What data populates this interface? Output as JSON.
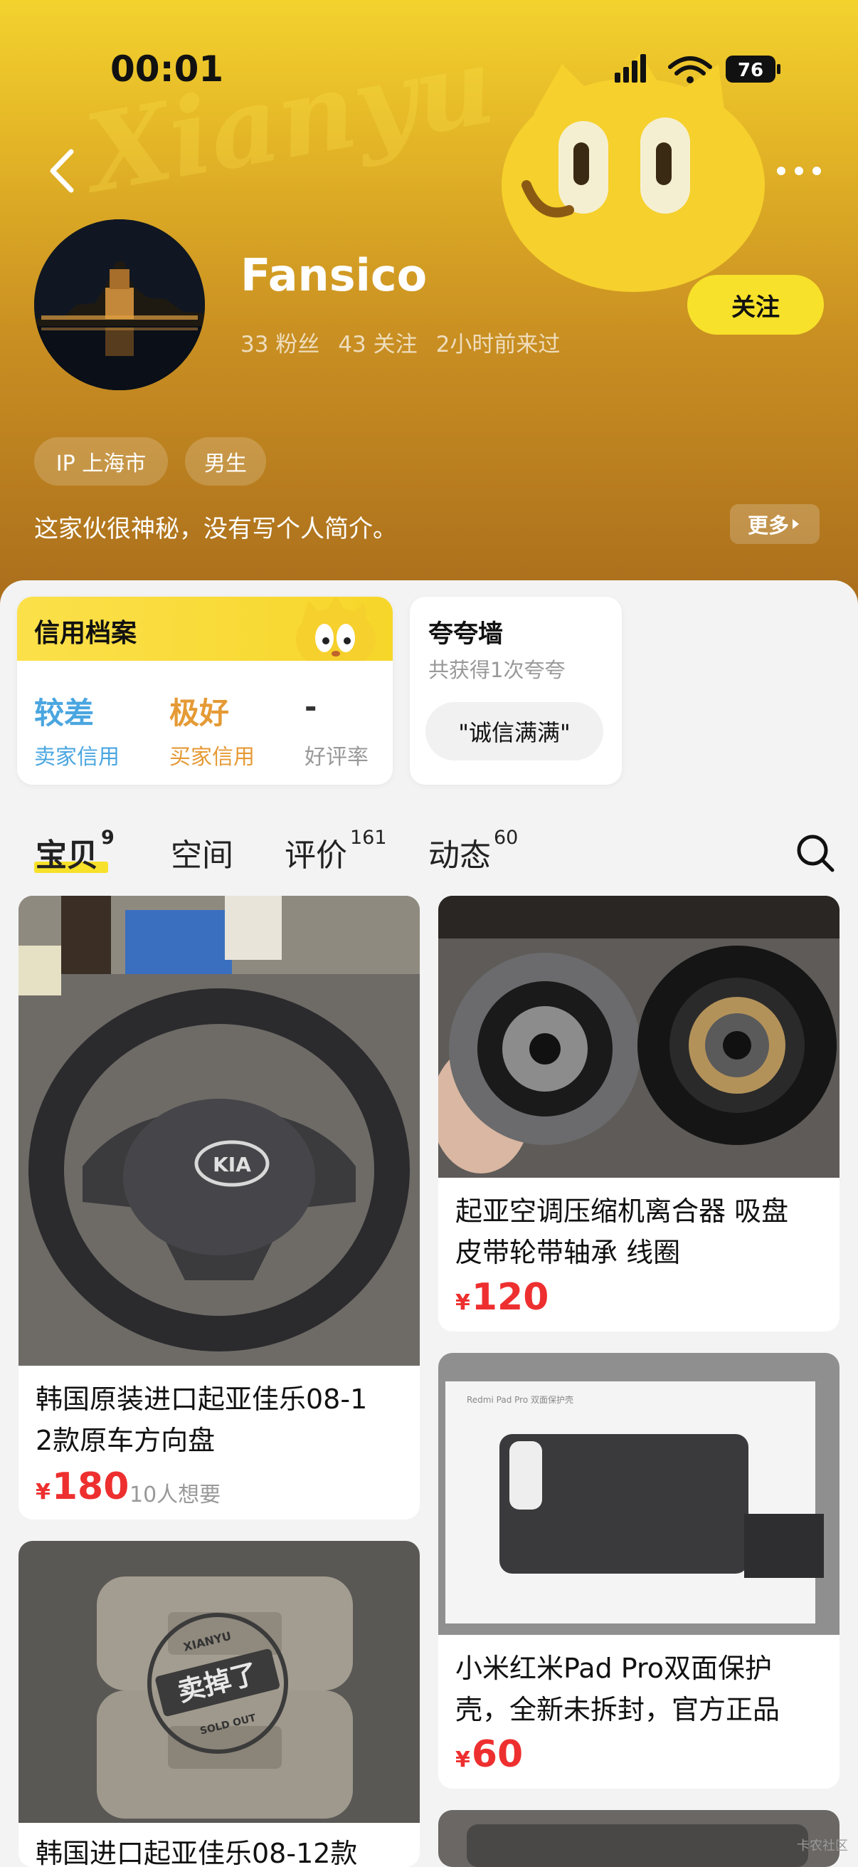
{
  "status_bar": {
    "time": "00:01",
    "battery": "76"
  },
  "profile": {
    "username": "Fansico",
    "stats": [
      "33 粉丝",
      "43 关注",
      "2小时前来过"
    ],
    "follow_label": "关注",
    "tags": [
      "IP 上海市",
      "男生"
    ],
    "bio": "这家伙很神秘，没有写个人简介。",
    "more_label": "更多"
  },
  "credit": {
    "title": "信用档案",
    "items": [
      {
        "value": "较差",
        "label": "卖家信用",
        "color": "#4aa6e0"
      },
      {
        "value": "极好",
        "label": "买家信用",
        "color": "#e59a35"
      },
      {
        "value": "-",
        "label": "好评率",
        "color": "#333333"
      }
    ]
  },
  "praise": {
    "title": "夸夸墙",
    "subtitle": "共获得1次夸夸",
    "chip": "\"诚信满满\""
  },
  "tabs": [
    {
      "label": "宝贝",
      "count": "9"
    },
    {
      "label": "空间",
      "count": ""
    },
    {
      "label": "评价",
      "count": "161"
    },
    {
      "label": "动态",
      "count": "60"
    }
  ],
  "products": [
    {
      "title_line1": "韩国原装进口起亚佳乐08-1",
      "title_line2": "2款原车方向盘",
      "currency": "¥",
      "price": "180",
      "want": "10人想要"
    },
    {
      "title_line1": "起亚空调压缩机离合器 吸盘",
      "title_line2": "皮带轮带轴承 线圈",
      "currency": "¥",
      "price": "120"
    },
    {
      "title_line1": "小米红米Pad Pro双面保护",
      "title_line2": "壳，全新未拆封，官方正品",
      "currency": "¥",
      "price": "60"
    },
    {
      "title_line1": "韩国进口起亚佳乐08-12款",
      "sold_stamp": "卖掉了",
      "stamp_top": "XIANYU",
      "stamp_bottom": "SOLD OUT"
    }
  ],
  "image_label": {
    "tablet_box": "Redmi Pad Pro 双面保护壳",
    "kia_logo": "KIA"
  },
  "corner_watermark": "卡农社区",
  "colors": {
    "accent_yellow": "#f7e12a",
    "price_red": "#ee2f2f"
  }
}
